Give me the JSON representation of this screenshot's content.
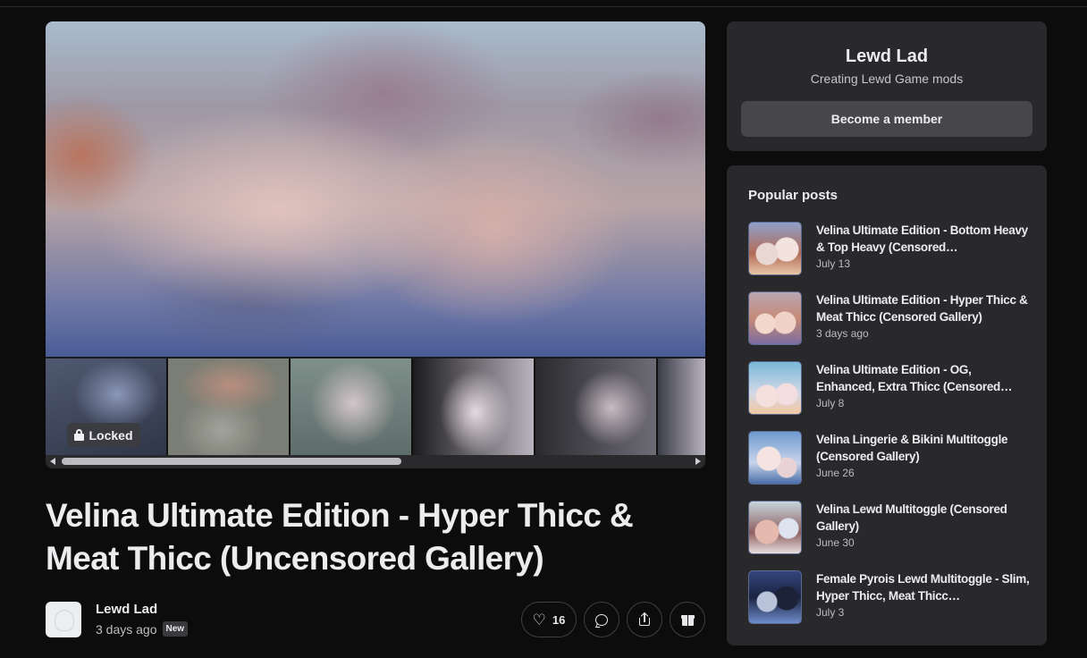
{
  "gallery": {
    "locked_label": "Locked"
  },
  "post": {
    "title": "Velina Ultimate Edition - Hyper Thicc & Meat Thicc (Uncensored Gallery)",
    "author": "Lewd Lad",
    "time": "3 days ago",
    "badge": "New",
    "likes": "16"
  },
  "icons": {
    "like": "heart-icon",
    "comment": "comment-icon",
    "share": "share-icon",
    "gift": "gift-icon",
    "lock": "lock-icon"
  },
  "creator": {
    "name": "Lewd Lad",
    "tagline": "Creating Lewd Game mods",
    "cta": "Become a member"
  },
  "popular": {
    "heading": "Popular posts",
    "items": [
      {
        "title": "Velina Ultimate Edition - Bottom Heavy & Top Heavy (Censored…",
        "date": "July 13"
      },
      {
        "title": "Velina Ultimate Edition - Hyper Thicc & Meat Thicc (Censored Gallery)",
        "date": "3 days ago"
      },
      {
        "title": "Velina Ultimate Edition - OG, Enhanced, Extra Thicc (Censored…",
        "date": "July 8"
      },
      {
        "title": "Velina Lingerie & Bikini Multitoggle (Censored Gallery)",
        "date": "June 26"
      },
      {
        "title": "Velina Lewd Multitoggle (Censored Gallery)",
        "date": "June 30"
      },
      {
        "title": "Female Pyrois Lewd Multitoggle - Slim, Hyper Thicc, Meat Thicc…",
        "date": "July 3"
      }
    ]
  },
  "colors": {
    "background": "#0c0c0d",
    "card": "#29292c",
    "button": "#47474b"
  }
}
